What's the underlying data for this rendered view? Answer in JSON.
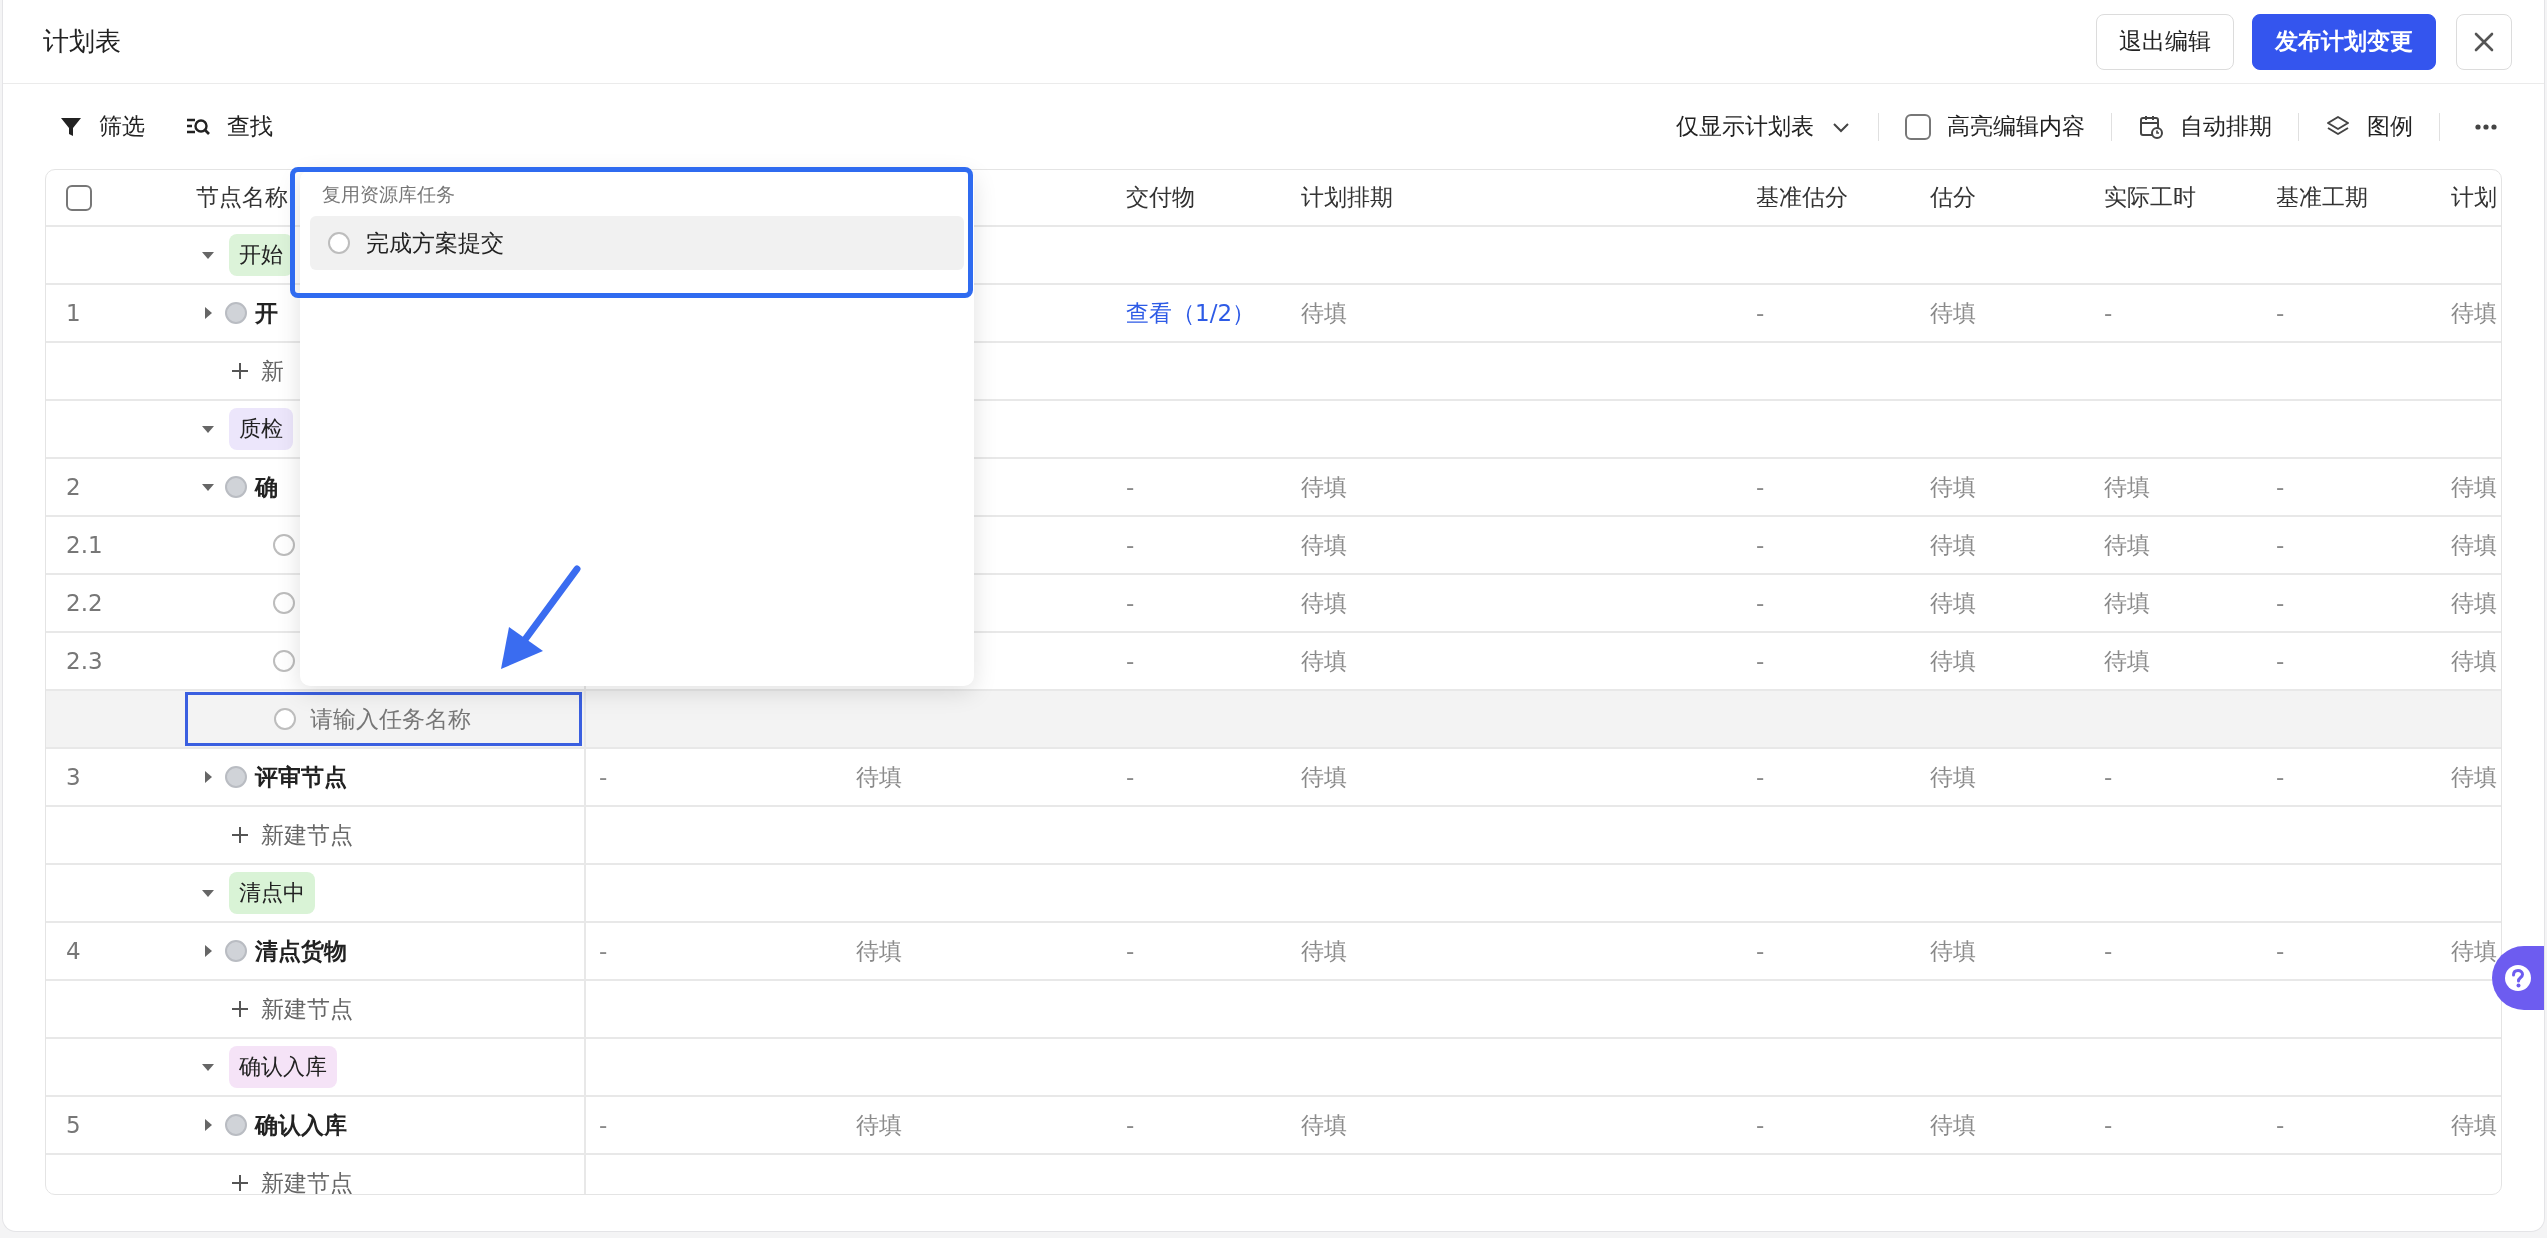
{
  "title": "计划表",
  "header_buttons": [
    {
      "label": "退出编辑",
      "kind": "secondary"
    },
    {
      "label": "发布计划变更",
      "kind": "primary"
    }
  ],
  "toolbar": {
    "left": [
      "筛选",
      "查找"
    ],
    "view": "仅显示计划表",
    "highlight": {
      "label": "高亮编辑内容",
      "checked": false
    },
    "actions": [
      "自动排期",
      "图例"
    ]
  },
  "table": {
    "select_all": {
      "checked": false
    },
    "columns": [
      "节点名称",
      null,
      null,
      "交付物",
      "计划排期",
      "基准估分",
      "估分",
      "实际工时",
      "基准工期",
      "计划"
    ],
    "rows": [
      {
        "kind": "group",
        "label": "开始",
        "color": "#dcf3d9",
        "expanded": true
      },
      {
        "kind": "task",
        "number": "1",
        "name": "开",
        "expanded": false,
        "cells": [
          null,
          null,
          {
            "text": "查看（1/2）",
            "kind": "link"
          },
          "待填",
          "-",
          "待填",
          "-",
          "-",
          "待填"
        ]
      },
      {
        "kind": "add",
        "label": "新"
      },
      {
        "kind": "group",
        "label": "质检",
        "color": "#ece6fb",
        "expanded": true
      },
      {
        "kind": "task",
        "number": "2",
        "name": "确",
        "expanded": true,
        "cells": [
          null,
          null,
          "-",
          "待填",
          "-",
          "待填",
          "待填",
          "-",
          "待填"
        ]
      },
      {
        "kind": "subtask",
        "number": "2.1",
        "cells": [
          null,
          null,
          "-",
          "待填",
          "-",
          "待填",
          "待填",
          "-",
          "待填"
        ]
      },
      {
        "kind": "subtask",
        "number": "2.2",
        "cells": [
          null,
          null,
          "-",
          "待填",
          "-",
          "待填",
          "待填",
          "-",
          "待填"
        ]
      },
      {
        "kind": "subtask",
        "number": "2.3",
        "cells": [
          null,
          null,
          "-",
          "待填",
          "-",
          "待填",
          "待填",
          "-",
          "待填"
        ]
      },
      {
        "kind": "input",
        "placeholder": "请输入任务名称"
      },
      {
        "kind": "task",
        "number": "3",
        "name": "评审节点",
        "expanded": false,
        "cells": [
          "-",
          "待填",
          "-",
          "待填",
          "-",
          "待填",
          "-",
          "-",
          "待填"
        ]
      },
      {
        "kind": "add",
        "label": "新建节点"
      },
      {
        "kind": "group",
        "label": "清点中",
        "color": "#d9f3d6",
        "expanded": true
      },
      {
        "kind": "task",
        "number": "4",
        "name": "清点货物",
        "expanded": false,
        "cells": [
          "-",
          "待填",
          "-",
          "待填",
          "-",
          "待填",
          "-",
          "-",
          "待填"
        ]
      },
      {
        "kind": "add",
        "label": "新建节点"
      },
      {
        "kind": "group",
        "label": "确认入库",
        "color": "#f5e3f7",
        "expanded": true
      },
      {
        "kind": "task",
        "number": "5",
        "name": "确认入库",
        "expanded": false,
        "cells": [
          "-",
          "待填",
          "-",
          "待填",
          "-",
          "待填",
          "-",
          "-",
          "待填"
        ]
      },
      {
        "kind": "add",
        "label": "新建节点"
      }
    ]
  },
  "dropdown": {
    "section": "复用资源库任务",
    "items": [
      {
        "label": "完成方案提交",
        "selected": true
      }
    ]
  }
}
